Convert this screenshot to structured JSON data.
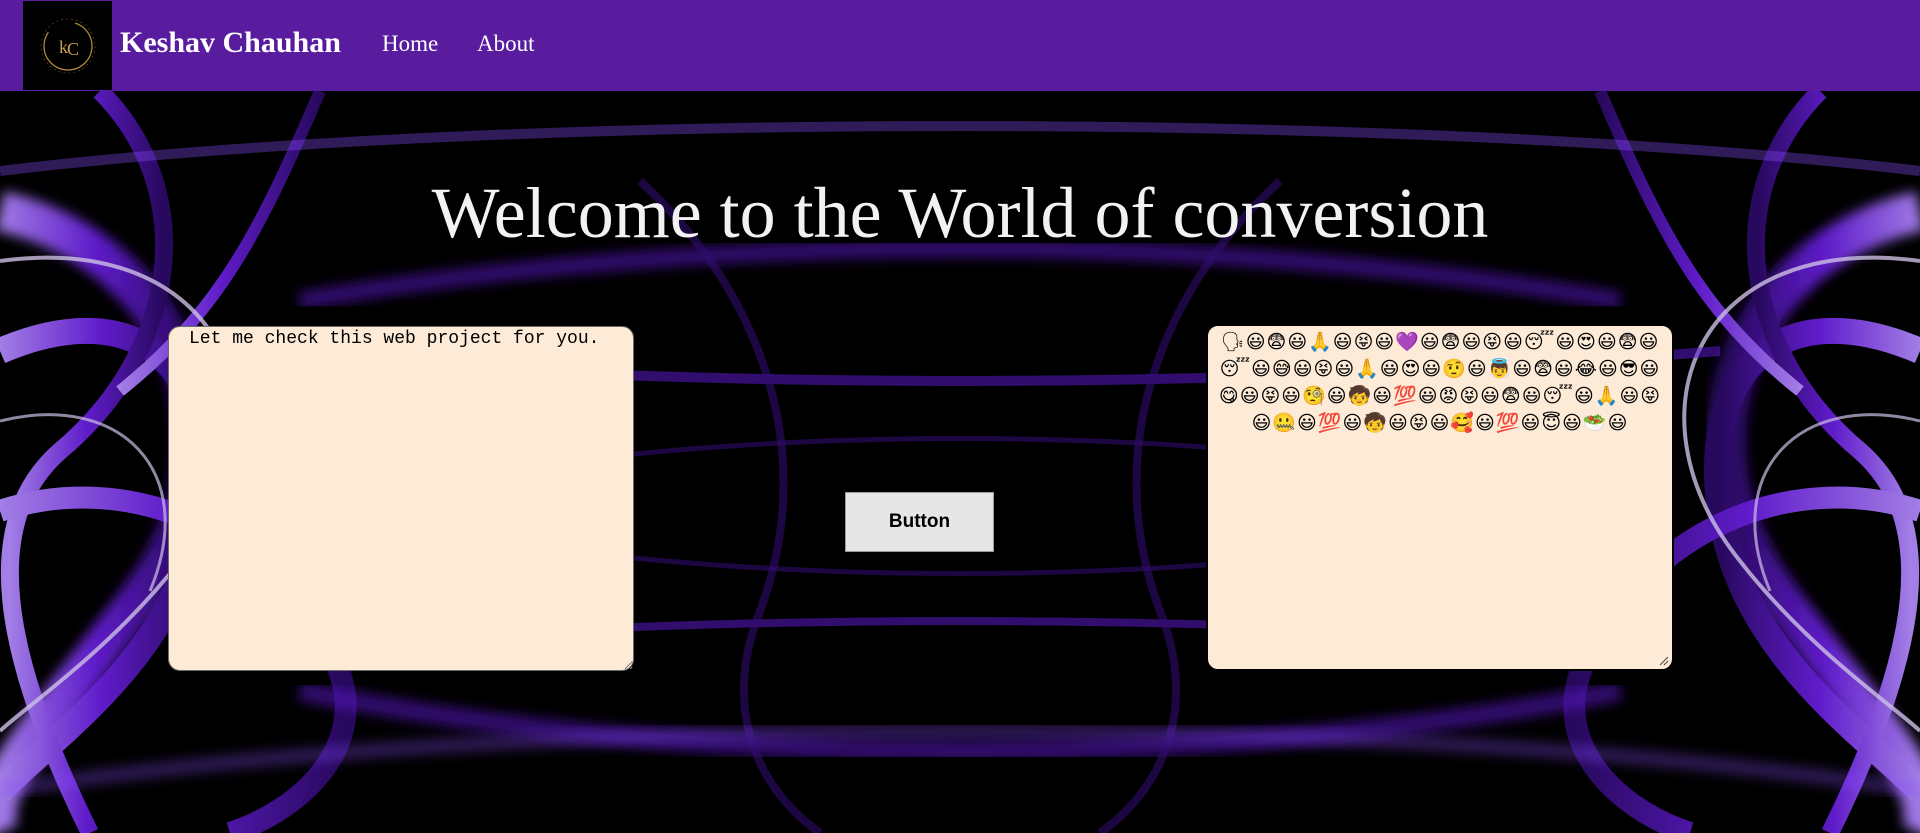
{
  "navbar": {
    "brand": "Keshav Chauhan",
    "links": [
      "Home",
      "About"
    ],
    "logo_icon": "kc-monogram-logo",
    "background": "#591c9f"
  },
  "main": {
    "title": "Welcome to the World of conversion",
    "input_value": "Let me check this web project for you.",
    "button_label": "Button",
    "output_value": "🗣😃😨😃🙏😃😝😃💜😃😨😃😝😃😴😃😍😃😨😃😴😃😅😃😝😃🙏😃😍😃🤨😃👼😃😨😃😂😃😎😃😋😃😝😃🧐😃🧒😃💯😃😡😝😃😨😃😴😃🙏😃😝😃🤐😃💯😃🧒😃😝😃🥰😃💯😃😇😃🥗😃"
  },
  "colors": {
    "textarea_bg": "#fdebd7",
    "accent": "#7a2cff"
  }
}
